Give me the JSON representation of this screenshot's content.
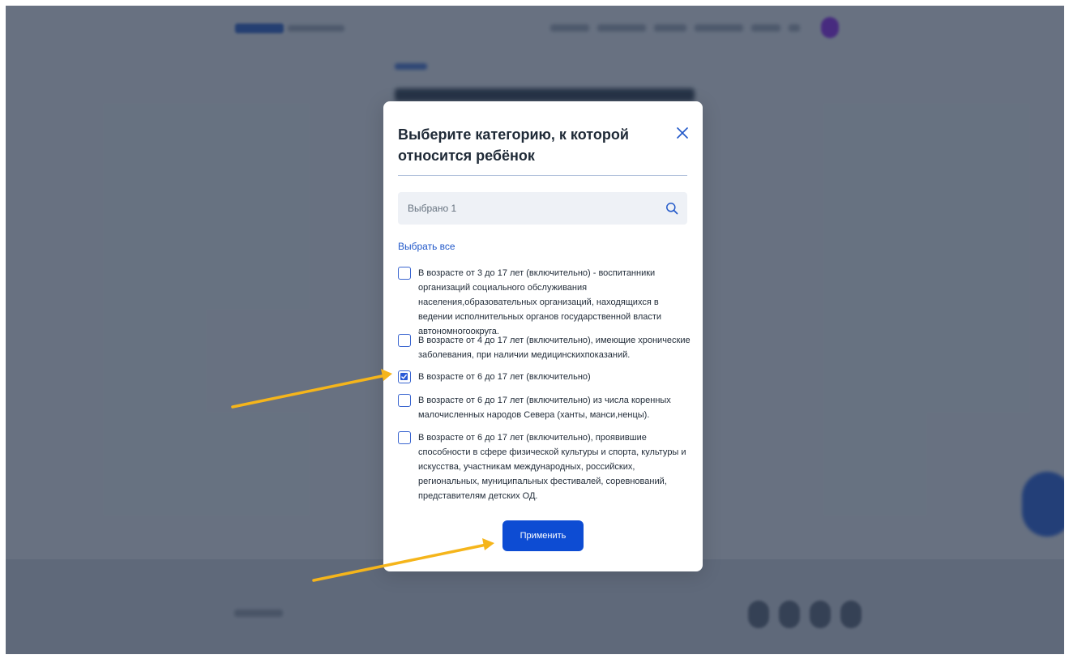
{
  "modal": {
    "title": "Выберите категорию, к которой относится ребёнок",
    "search_placeholder": "Выбрано 1",
    "select_all": "Выбрать все",
    "options": [
      {
        "label": "В возрасте от 3 до 17 лет (включительно) - воспитанники организаций социального обслуживания населения,образовательных организаций, находящихся в ведении исполнительных органов государственной власти автономногоокруга.",
        "checked": false
      },
      {
        "label": "В возрасте от 4 до 17 лет (включительно), имеющие хронические заболевания, при наличии медицинскихпоказаний.",
        "checked": false
      },
      {
        "label": "В возрасте от 6 до 17 лет (включительно)",
        "checked": true
      },
      {
        "label": "В возрасте от 6 до 17 лет (включительно) из числа коренных малочисленных народов Севера (ханты, манси,ненцы).",
        "checked": false
      },
      {
        "label": "В возрасте от 6 до 17 лет (включительно), проявившие способности в сфере физической культуры и спорта, культуры и искусства, участникам международных, российских, региональных, муниципальных фестивалей, соревнований, представителям детских ОД.",
        "checked": false
      }
    ],
    "apply_label": "Применить"
  },
  "icons": {
    "close": "close-icon",
    "search": "search-icon",
    "arrow": "arrow-annotation"
  },
  "colors": {
    "accent": "#0d4cd3",
    "link": "#2158c9",
    "arrow": "#f5b51b",
    "overlay": "#1e2c42"
  }
}
